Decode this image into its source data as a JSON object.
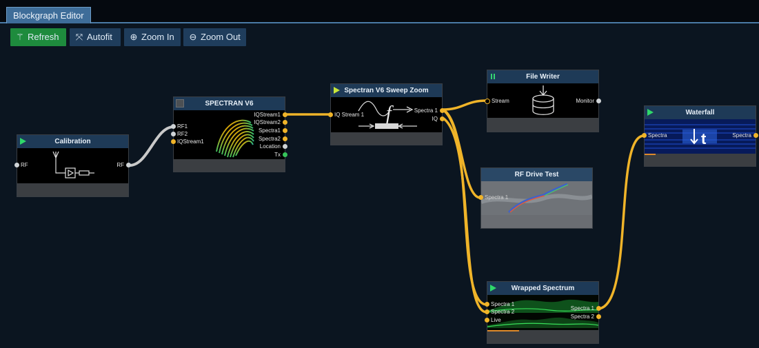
{
  "tab": {
    "title": "Blockgraph Editor"
  },
  "toolbar": {
    "refresh_label": "Refresh",
    "autofit_label": "Autofit",
    "zoom_in_label": "Zoom In",
    "zoom_out_label": "Zoom Out"
  },
  "nodes": {
    "calibration": {
      "title": "Calibration",
      "in_rf": "RF",
      "out_rf": "RF"
    },
    "spectran": {
      "title": "SPECTRAN V6",
      "in": [
        "RF1",
        "RF2",
        "IQStream1"
      ],
      "out": [
        "IQStream1",
        "IQStream2",
        "Spectra1",
        "Spectra2",
        "Location",
        "Tx"
      ]
    },
    "sweep_zoom": {
      "title": "Spectran V6 Sweep Zoom",
      "in": "IQ Stream 1",
      "out": [
        "Spectra 1",
        "IQ"
      ],
      "glyph": "f"
    },
    "file_writer": {
      "title": "File Writer",
      "in": "Stream",
      "out": "Monitor"
    },
    "rf_drive_test": {
      "title": "RF Drive Test",
      "in": "Spectra 1"
    },
    "waterfall": {
      "title": "Waterfall",
      "in": "Spectra",
      "out": "Spectra",
      "glyph": "t"
    },
    "wrapped_spectrum": {
      "title": "Wrapped Spectrum",
      "in": [
        "Spectra 1",
        "Spectra 2",
        "Live"
      ],
      "out": [
        "Spectra 1",
        "Spectra 2"
      ]
    }
  },
  "colors": {
    "accent": "#3e6d99",
    "connection": "#f0b429",
    "refresh": "#1e8b3d",
    "header": "#1e3a57"
  },
  "icons": {
    "refresh": "wand-icon",
    "autofit": "autofit-icon",
    "zoom_in": "zoom-in-icon",
    "zoom_out": "zoom-out-icon"
  }
}
